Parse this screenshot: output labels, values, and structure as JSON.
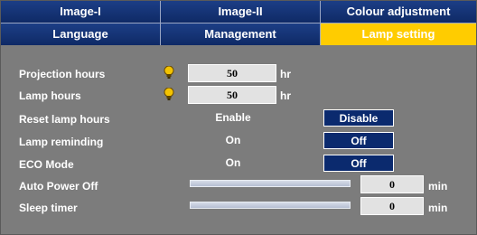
{
  "tabs_row1": [
    {
      "label": "Image-I"
    },
    {
      "label": "Image-II"
    },
    {
      "label": "Colour adjustment"
    }
  ],
  "tabs_row2": [
    {
      "label": "Language"
    },
    {
      "label": "Management"
    },
    {
      "label": "Lamp setting"
    }
  ],
  "active_tab": "Lamp setting",
  "colors": {
    "active_tab": "#ffcc00",
    "tab_bg": "#1c3e86",
    "panel_bg": "#7c7c7c",
    "selected_option": "#0b2a6e"
  },
  "settings": {
    "projection_hours": {
      "label": "Projection hours",
      "icon": "lamp-bulb-icon",
      "value": "50",
      "unit": "hr"
    },
    "lamp_hours": {
      "label": "Lamp hours",
      "icon": "lamp-bulb-icon",
      "value": "50",
      "unit": "hr"
    },
    "reset_lamp_hours": {
      "label": "Reset lamp hours",
      "option_a": "Enable",
      "option_b": "Disable",
      "selected": "Disable"
    },
    "lamp_reminding": {
      "label": "Lamp reminding",
      "option_a": "On",
      "option_b": "Off",
      "selected": "Off"
    },
    "eco_mode": {
      "label": "ECO Mode",
      "option_a": "On",
      "option_b": "Off",
      "selected": "Off"
    },
    "auto_power_off": {
      "label": "Auto Power Off",
      "value": "0",
      "unit": "min",
      "level": 0
    },
    "sleep_timer": {
      "label": "Sleep timer",
      "value": "0",
      "unit": "min",
      "level": 0
    }
  }
}
